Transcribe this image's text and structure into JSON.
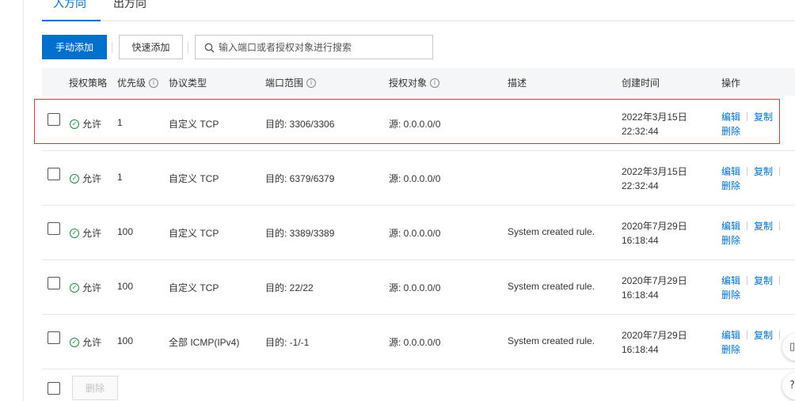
{
  "tabs": [
    {
      "label": "入方向",
      "active": true
    },
    {
      "label": "出方向",
      "active": false
    }
  ],
  "toolbar": {
    "manual_add": "手动添加",
    "quick_add": "快速添加"
  },
  "search": {
    "placeholder": "输入端口或者授权对象进行搜索",
    "value": ""
  },
  "table": {
    "headers": {
      "policy": "授权策略",
      "priority": "优先级",
      "protocol": "协议类型",
      "port": "端口范围",
      "auth": "授权对象",
      "desc": "描述",
      "created": "创建时间",
      "ops": "操作"
    },
    "ops": {
      "edit": "编辑",
      "copy": "复制",
      "delete": "删除"
    },
    "rows": [
      {
        "policy": "允许",
        "priority": "1",
        "protocol": "自定义 TCP",
        "port": "目的: 3306/3306",
        "auth": "源: 0.0.0.0/0",
        "desc": "",
        "date": "2022年3月15日",
        "time": "22:32:44"
      },
      {
        "policy": "允许",
        "priority": "1",
        "protocol": "自定义 TCP",
        "port": "目的: 6379/6379",
        "auth": "源: 0.0.0.0/0",
        "desc": "",
        "date": "2022年3月15日",
        "time": "22:32:44"
      },
      {
        "policy": "允许",
        "priority": "100",
        "protocol": "自定义 TCP",
        "port": "目的: 3389/3389",
        "auth": "源: 0.0.0.0/0",
        "desc": "System created rule.",
        "date": "2020年7月29日",
        "time": "16:18:44"
      },
      {
        "policy": "允许",
        "priority": "100",
        "protocol": "自定义 TCP",
        "port": "目的: 22/22",
        "auth": "源: 0.0.0.0/0",
        "desc": "System created rule.",
        "date": "2020年7月29日",
        "time": "16:18:44"
      },
      {
        "policy": "允许",
        "priority": "100",
        "protocol": "全部 ICMP(IPv4)",
        "port": "目的: -1/-1",
        "auth": "源: 0.0.0.0/0",
        "desc": "System created rule.",
        "date": "2020年7月29日",
        "time": "16:18:44"
      }
    ]
  },
  "footer": {
    "delete_label": "删除"
  },
  "colors": {
    "primary": "#0070cc",
    "success": "#1e8e3e",
    "highlight": "#d9363e"
  }
}
